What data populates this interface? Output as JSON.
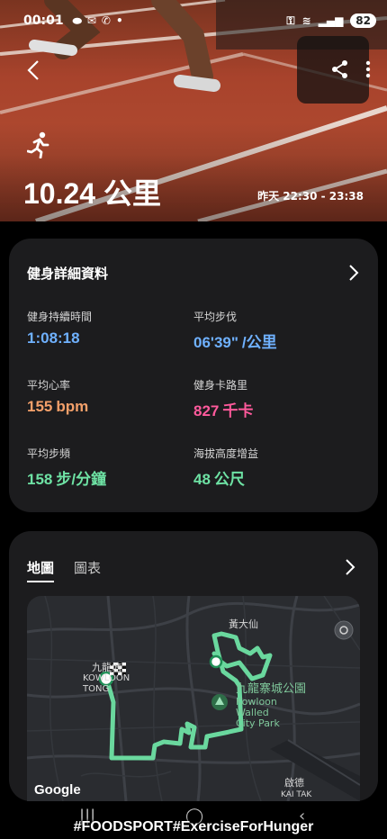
{
  "status_bar": {
    "time": "00:01",
    "battery": "82"
  },
  "hero": {
    "distance": "10.24 公里",
    "date_range": "昨天 22:30 - 23:38"
  },
  "details_card": {
    "title": "健身詳細資料",
    "metrics": [
      {
        "label": "健身持續時間",
        "value": "1:08:18",
        "unit": "",
        "color": "#6fb1ff"
      },
      {
        "label": "平均步伐",
        "value": "06'39\"",
        "unit": "/公里",
        "color": "#6fb1ff"
      },
      {
        "label": "平均心率",
        "value": "155",
        "unit": "bpm",
        "color": "#f4a06a"
      },
      {
        "label": "健身卡路里",
        "value": "827",
        "unit": "千卡",
        "color": "#ff5a9c"
      },
      {
        "label": "平均步頻",
        "value": "158",
        "unit": "步/分鐘",
        "color": "#6ee2a4"
      },
      {
        "label": "海拔高度增益",
        "value": "48",
        "unit": "公尺",
        "color": "#6ee2a4"
      }
    ]
  },
  "map_card": {
    "tabs": [
      {
        "label": "地圖",
        "active": true
      },
      {
        "label": "圖表",
        "active": false
      }
    ],
    "map_labels": {
      "kowloon_tong_zh": "九龍塘",
      "kowloon_tong_en": "KOWLOON\nTONG",
      "wong_tai_sin": "黃大仙",
      "walled_city_zh": "九龍寨城公園",
      "walled_city_en": "Kowloon\nWalled\nCity Park",
      "kai_tak_zh": "啟德",
      "kai_tak_en": "KAI TAK"
    },
    "attribution": "Google",
    "route_color": "#6ee2a4"
  },
  "footer": {
    "hashtag": "#FOODSPORT#ExerciseForHunger"
  }
}
